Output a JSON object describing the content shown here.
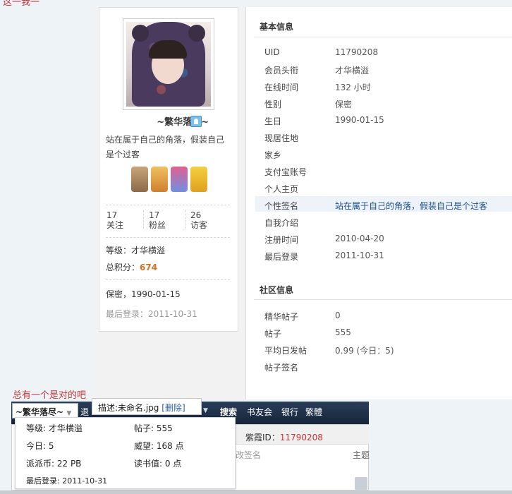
{
  "top_stray_text": "这一我一",
  "profile": {
    "nickname": "~繁华落尽~",
    "signature": "站在属于自己的角落，假装自己是个过客",
    "stats": [
      {
        "count": "17",
        "label": "关注"
      },
      {
        "count": "17",
        "label": "粉丝"
      },
      {
        "count": "26",
        "label": "访客"
      }
    ],
    "level_label": "等级：",
    "level": "才华横溢",
    "score_label": "总积分：",
    "score": "674",
    "gender_birth": "保密，1990-01-15",
    "last_login": "最后登录：2011-10-31"
  },
  "basic_info": {
    "title": "基本信息",
    "rows": [
      {
        "label": "UID",
        "value": "11790208"
      },
      {
        "label": "会员头衔",
        "value": "才华横溢"
      },
      {
        "label": "在线时间",
        "value": "132 小时"
      },
      {
        "label": "性别",
        "value": "保密"
      },
      {
        "label": "生日",
        "value": "1990-01-15"
      },
      {
        "label": "现居住地",
        "value": ""
      },
      {
        "label": "家乡",
        "value": ""
      },
      {
        "label": "支付宝账号",
        "value": ""
      },
      {
        "label": "个人主页",
        "value": ""
      },
      {
        "label": "个性签名",
        "value": "站在属于自己的角落，假装自己是个过客"
      },
      {
        "label": "自我介绍",
        "value": ""
      },
      {
        "label": "注册时间",
        "value": "2010-04-20"
      },
      {
        "label": "最后登录",
        "value": "2011-10-31"
      }
    ]
  },
  "community_info": {
    "title": "社区信息",
    "rows": [
      {
        "label": "精华帖子",
        "value": "0"
      },
      {
        "label": "帖子",
        "value": "555"
      },
      {
        "label": "平均日发帖",
        "value": "0.99 (今日：5)"
      },
      {
        "label": "帖子签名",
        "value": ""
      }
    ]
  },
  "bottom": {
    "red_text": "总有一个是对的吧",
    "user_menu": "~繁华落尽~",
    "nav_tui": "退",
    "desc_label": "描述:未命名.jpg",
    "desc_delete": "[删除]",
    "nav_links": [
      "搜索",
      "书友会",
      "银行",
      "繁體"
    ],
    "under_yi": "溢",
    "under_purple_label": "紫霞ID：",
    "under_purple_id": "11790208",
    "under_edit": "“ 修改签名",
    "under_topic": "主题",
    "popup": {
      "level": "等级: 才华横溢",
      "posts": "帖子: 555",
      "today": "今日: 5",
      "prestige": "威望: 168 点",
      "coins": "派派币: 22 PB",
      "reading": "读书值: 0 点",
      "last_login": "最后登录: 2011-10-31"
    }
  },
  "colors": {
    "accent_orange": "#e07020",
    "link_blue": "#1b4d8a",
    "nav_dark": "#1f2f48",
    "red_text": "#cc3333"
  }
}
